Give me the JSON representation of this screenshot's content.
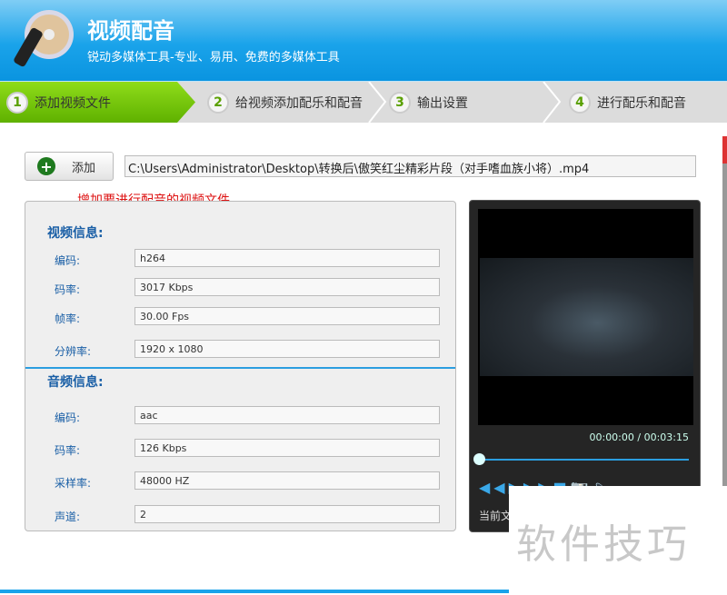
{
  "header": {
    "title": "视频配音",
    "subtitle": "锐动多媒体工具-专业、易用、免费的多媒体工具"
  },
  "steps": [
    {
      "num": "1",
      "label": "添加视频文件",
      "active": true
    },
    {
      "num": "2",
      "label": "给视频添加配乐和配音"
    },
    {
      "num": "3",
      "label": "输出设置"
    },
    {
      "num": "4",
      "label": "进行配乐和配音"
    }
  ],
  "toolbar": {
    "add_label": "添加",
    "path": "C:\\Users\\Administrator\\Desktop\\转换后\\傲笑红尘精彩片段（对手嗜血族小将）.mp4",
    "hint": "增加要进行配音的视频文件"
  },
  "video_info": {
    "heading": "视频信息:",
    "rows": [
      {
        "label": "编码:",
        "value": "h264"
      },
      {
        "label": "码率:",
        "value": "3017 Kbps"
      },
      {
        "label": "帧率:",
        "value": "30.00 Fps"
      },
      {
        "label": "分辨率:",
        "value": "1920 x 1080"
      }
    ]
  },
  "audio_info": {
    "heading": "音频信息:",
    "rows": [
      {
        "label": "编码:",
        "value": "aac"
      },
      {
        "label": "码率:",
        "value": "126 Kbps"
      },
      {
        "label": "采样率:",
        "value": "48000 HZ"
      },
      {
        "label": "声道:",
        "value": "2"
      }
    ]
  },
  "player": {
    "time": "00:00:00 / 00:03:15",
    "progress": 0,
    "current_file_label": "当前文"
  },
  "watermark": "软件技巧",
  "colors": {
    "accent": "#1aa3ea",
    "active_step": "#6cc000",
    "hint": "#d11111"
  }
}
